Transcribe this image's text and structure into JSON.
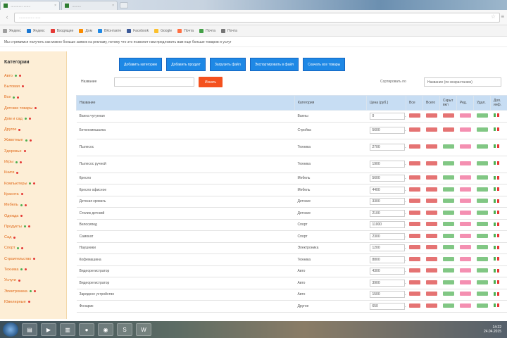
{
  "browser": {
    "tabs": [
      {
        "label": "............ ......."
      },
      {
        "label": "........."
      }
    ],
    "url": "............... ......",
    "bookmarks": [
      "Яндекс",
      "Яндекс",
      "Входящие",
      "Дом",
      "ВКонтакте",
      "Facebook",
      "Google",
      "Почта",
      "Почта",
      "Почта"
    ]
  },
  "notice": "Мы стремимся получить как можно больше заявок на рекламу, потому что это позволит нам предложить вам еще больше товаров и услуг",
  "sidebar": {
    "title": "Категории",
    "items": [
      "Авто",
      "Бытовая",
      "Все",
      "Детские товары",
      "Дом и сад",
      "Другое",
      "Животные",
      "Здоровье",
      "Игры",
      "Книги",
      "Компьютеры",
      "Красота",
      "Мебель",
      "Одежда",
      "Продукты",
      "Сад",
      "Спорт",
      "Строительство",
      "Техника",
      "Услуги",
      "Электроника",
      "Ювелирные"
    ]
  },
  "actions": {
    "buttons": [
      "Добавить категорию",
      "Добавить продукт",
      "Загрузить файл",
      "Экспортировать в файл",
      "Скачать все товары"
    ]
  },
  "filter": {
    "label": "Название",
    "search_button": "Искать",
    "sort_label": "Сортировать по",
    "sort_value": "Название (по возрастанию)"
  },
  "table": {
    "headers": [
      "Название",
      "Категория",
      "Цена (руб.)",
      "Все",
      "Всего",
      "Скрыт вкл",
      "Ред.",
      "Удал.",
      "Доп. инф."
    ],
    "rows": [
      {
        "name": "Ванна чугунная",
        "cat": "Ванны",
        "price": "0"
      },
      {
        "name": "Бетономешалка",
        "cat": "Стройка",
        "price": "5600"
      },
      {
        "name": "Пылесос",
        "cat": "Техника",
        "price": "2700"
      },
      {
        "name": "Пылесос ручной",
        "cat": "Техника",
        "price": "1900"
      },
      {
        "name": "Кресло",
        "cat": "Мебель",
        "price": "5600"
      },
      {
        "name": "Кресло офисное",
        "cat": "Мебель",
        "price": "4400"
      },
      {
        "name": "Детская кровать",
        "cat": "Детские",
        "price": "3300"
      },
      {
        "name": "Столик детский",
        "cat": "Детские",
        "price": "2100"
      },
      {
        "name": "Велосипед",
        "cat": "Спорт",
        "price": "11000"
      },
      {
        "name": "Самокат",
        "cat": "Спорт",
        "price": "2300"
      },
      {
        "name": "Наушники",
        "cat": "Электроника",
        "price": "1200"
      },
      {
        "name": "Кофемашина",
        "cat": "Техника",
        "price": "8800"
      },
      {
        "name": "Видеорегистратор",
        "cat": "Авто",
        "price": "4300"
      },
      {
        "name": "Видеорегистратор",
        "cat": "Авто",
        "price": "3900"
      },
      {
        "name": "Зарядное устройство",
        "cat": "Авто",
        "price": "1500"
      },
      {
        "name": "Фонарик",
        "cat": "Другое",
        "price": "650"
      }
    ]
  },
  "taskbar": {
    "time": "14:22",
    "date": "24.04.2015"
  }
}
